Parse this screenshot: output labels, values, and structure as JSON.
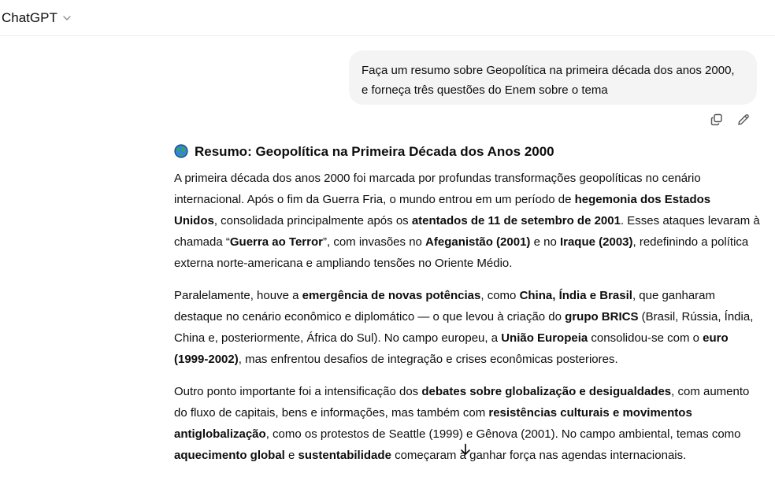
{
  "header": {
    "model_name": "ChatGPT",
    "model_chevron_icon": "chevron-down-icon"
  },
  "user_message": {
    "lines": [
      "Faça um resumo sobre Geopolítica na primeira década dos anos 2000,",
      "e forneça três questões do Enem sobre o tema"
    ],
    "actions": {
      "copy_icon": "copy-icon",
      "edit_icon": "edit-pencil-icon"
    }
  },
  "assistant": {
    "heading_icon": "globe-icon",
    "heading": "Resumo: Geopolítica na Primeira Década dos Anos 2000",
    "paragraphs": [
      [
        [
          [
            "t",
            "A primeira década dos anos 2000 foi marcada por profundas transformações geopolíticas no cenário"
          ]
        ],
        [
          [
            "t",
            "internacional. Após o fim da Guerra Fria, o mundo entrou em um período de "
          ],
          [
            "b",
            "hegemonia dos Estados"
          ]
        ],
        [
          [
            "b",
            "Unidos"
          ],
          [
            "t",
            ", consolidada principalmente após os "
          ],
          [
            "b",
            "atentados de 11 de setembro de 2001"
          ],
          [
            "t",
            ". Esses ataques levaram à"
          ]
        ],
        [
          [
            "t",
            "chamada “"
          ],
          [
            "b",
            "Guerra ao Terror"
          ],
          [
            "t",
            "”, com invasões no "
          ],
          [
            "b",
            "Afeganistão (2001)"
          ],
          [
            "t",
            " e no "
          ],
          [
            "b",
            "Iraque (2003)"
          ],
          [
            "t",
            ", redefinindo a política"
          ]
        ],
        [
          [
            "t",
            "externa norte-americana e ampliando tensões no Oriente Médio."
          ]
        ]
      ],
      [
        [
          [
            "t",
            "Paralelamente, houve a "
          ],
          [
            "b",
            "emergência de novas potências"
          ],
          [
            "t",
            ", como "
          ],
          [
            "b",
            "China, Índia e Brasil"
          ],
          [
            "t",
            ", que ganharam"
          ]
        ],
        [
          [
            "t",
            "destaque no cenário econômico e diplomático — o que levou à criação do "
          ],
          [
            "b",
            "grupo BRICS"
          ],
          [
            "t",
            " (Brasil, Rússia, Índia,"
          ]
        ],
        [
          [
            "t",
            "China e, posteriormente, África do Sul). No campo europeu, a "
          ],
          [
            "b",
            "União Europeia"
          ],
          [
            "t",
            " consolidou-se com o "
          ],
          [
            "b",
            "euro"
          ]
        ],
        [
          [
            "b",
            "(1999-2002)"
          ],
          [
            "t",
            ", mas enfrentou desafios de integração e crises econômicas posteriores."
          ]
        ]
      ],
      [
        [
          [
            "t",
            "Outro ponto importante foi a intensificação dos "
          ],
          [
            "b",
            "debates sobre globalização e desigualdades"
          ],
          [
            "t",
            ", com aumento"
          ]
        ],
        [
          [
            "t",
            "do fluxo de capitais, bens e informações, mas também com "
          ],
          [
            "b",
            "resistências culturais e movimentos"
          ]
        ],
        [
          [
            "b",
            "antiglobalização"
          ],
          [
            "t",
            ", como os protestos de Seattle (1999) e Gênova (2001). No campo ambiental, temas como"
          ]
        ],
        [
          [
            "b",
            "aquecimento global"
          ],
          [
            "t",
            " e "
          ],
          [
            "b",
            "sustentabilidade"
          ],
          [
            "t",
            " começaram a ganhar força nas agendas internacionais."
          ]
        ]
      ]
    ]
  },
  "scroll_down_icon": "arrow-down-icon"
}
